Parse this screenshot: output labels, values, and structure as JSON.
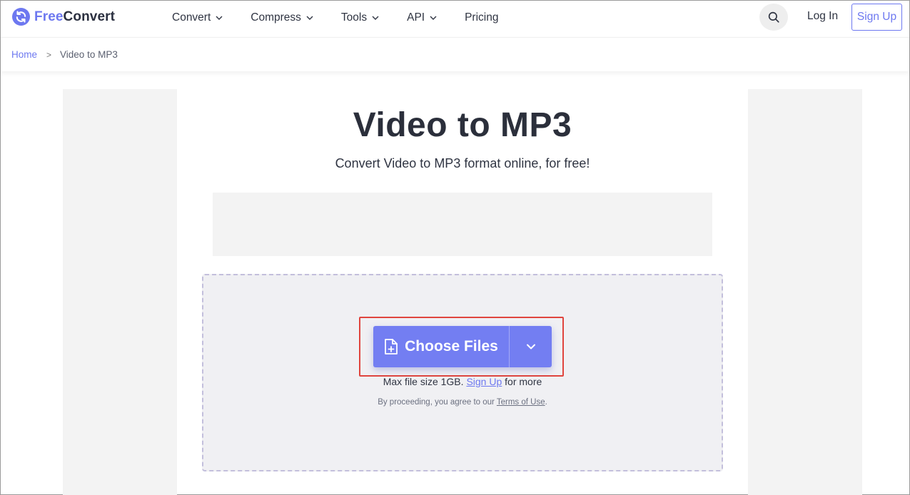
{
  "header": {
    "logo_free": "Free",
    "logo_convert": "Convert",
    "nav": [
      {
        "label": "Convert",
        "has_dropdown": true
      },
      {
        "label": "Compress",
        "has_dropdown": true
      },
      {
        "label": "Tools",
        "has_dropdown": true
      },
      {
        "label": "API",
        "has_dropdown": true
      },
      {
        "label": "Pricing",
        "has_dropdown": false
      }
    ],
    "search_icon": "search-icon",
    "login_label": "Log In",
    "signup_label": "Sign Up"
  },
  "breadcrumb": {
    "home": "Home",
    "separator": ">",
    "current": "Video to MP3"
  },
  "main": {
    "title": "Video to MP3",
    "subtitle": "Convert Video to MP3 format online, for free!"
  },
  "upload": {
    "choose_files_label": "Choose Files",
    "max_size_prefix": "Max file size 1GB.",
    "max_size_link": "Sign Up",
    "max_size_suffix": "for more",
    "terms_prefix": "By proceeding, you agree to our",
    "terms_link": "Terms of Use",
    "terms_suffix": "."
  },
  "colors": {
    "accent": "#6d78f0",
    "button": "#737ef2",
    "highlight_border": "#e0453e",
    "dropzone_bg": "#f0f0f3",
    "dropzone_border": "#c3bfdc"
  }
}
